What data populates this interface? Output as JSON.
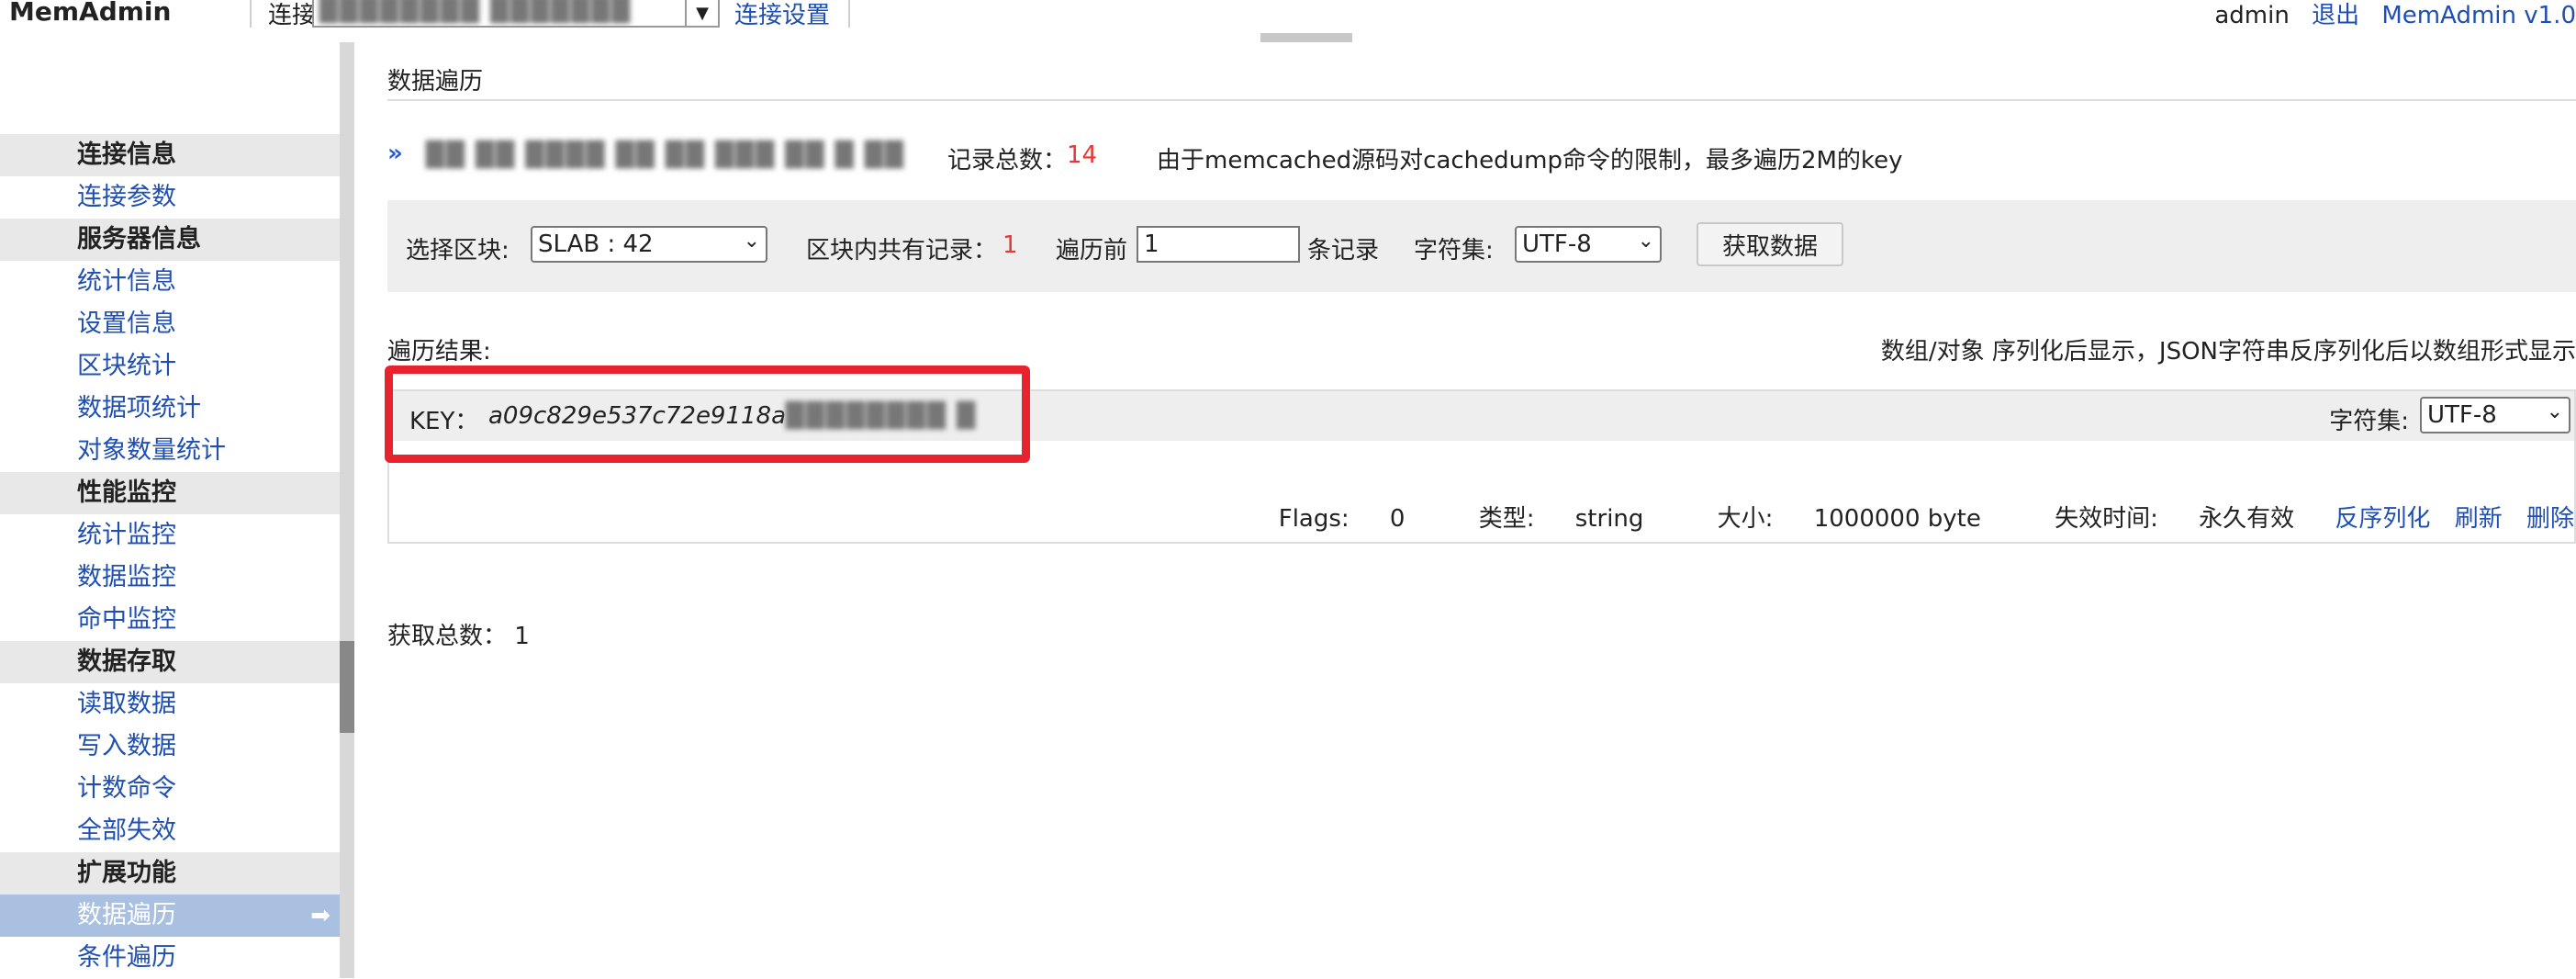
{
  "topbar": {
    "brand": "MemAdmin",
    "connection_label": "连接",
    "connection_value": "████████ ███████",
    "connection_settings": "连接设置",
    "user": "admin",
    "logout": "退出",
    "version": "MemAdmin v1.0"
  },
  "sidebar": {
    "groups": [
      {
        "title": "连接信息",
        "items": [
          "连接参数"
        ]
      },
      {
        "title": "服务器信息",
        "items": [
          "统计信息",
          "设置信息",
          "区块统计",
          "数据项统计",
          "对象数量统计"
        ]
      },
      {
        "title": "性能监控",
        "items": [
          "统计监控",
          "数据监控",
          "命中监控"
        ]
      },
      {
        "title": "数据存取",
        "items": [
          "读取数据",
          "写入数据",
          "计数命令",
          "全部失效"
        ]
      },
      {
        "title": "扩展功能",
        "items": [
          "数据遍历",
          "条件遍历"
        ]
      }
    ],
    "active_item": "数据遍历"
  },
  "main": {
    "page_title": "数据遍历",
    "server_name": "██ ██ ████ ██ ██ ███ ██ █ ██",
    "total_label": "记录总数：",
    "total_value": "14",
    "notice": "由于memcached源码对cachedump命令的限制，最多遍历2M的key",
    "slab_label": "选择区块:",
    "slab_value": "SLAB : 42",
    "records_in_slab_label": "区块内共有记录：",
    "records_in_slab_value": "1",
    "traverse_prefix": "遍历前",
    "traverse_count": "1",
    "traverse_suffix": "条记录",
    "charset_label": "字符集:",
    "charset_value": "UTF-8",
    "fetch_button": "获取数据",
    "result_label": "遍历结果:",
    "serialize_note": "数组/对象 序列化后显示，JSON字符串反序列化后以数组形式显示",
    "key_label": "KEY：",
    "key_value": "a09c829e537c72e9118a",
    "key_value_hidden": "████████ █",
    "key_charset_label": "字符集:",
    "key_charset_value": "UTF-8",
    "flags_label": "Flags:",
    "flags_value": "0",
    "type_label": "类型:",
    "type_value": "string",
    "size_label": "大小:",
    "size_value": "1000000 byte",
    "expire_label": "失效时间:",
    "expire_value": "永久有效",
    "action_unserialize": "反序列化",
    "action_refresh": "刷新",
    "action_delete": "删除",
    "fetch_total_label": "获取总数：",
    "fetch_total_value": "1"
  },
  "colors": {
    "link": "#1f4fb3",
    "highlight": "#e8232d",
    "active_nav": "#a9c0e0",
    "count_red": "#e53935"
  }
}
